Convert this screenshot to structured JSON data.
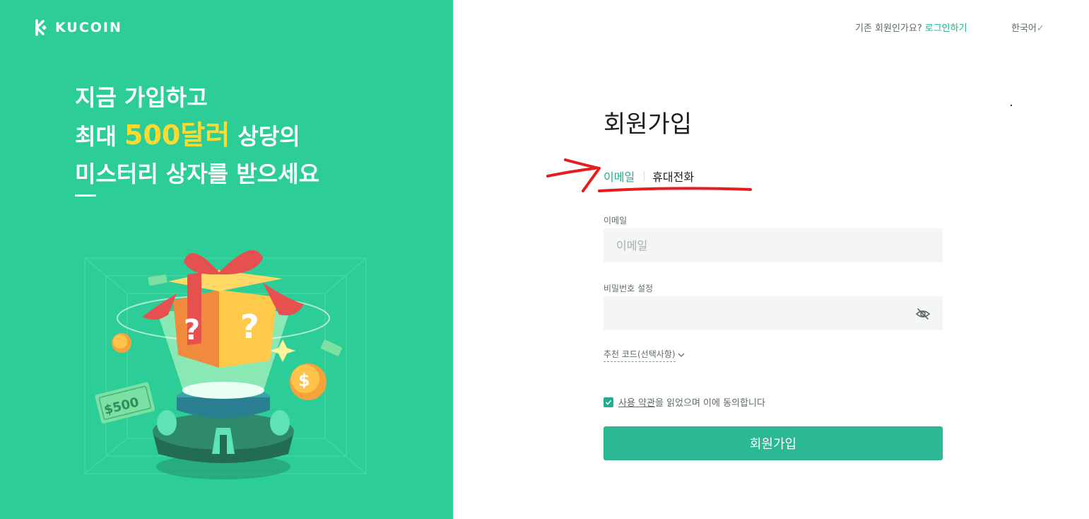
{
  "brand": {
    "name": "KUCOIN",
    "accent": "#24ae8f",
    "panel_color": "#2ccd96",
    "highlight_color": "#ffd92e"
  },
  "promo": {
    "line1": "지금 가입하고",
    "line2_prefix": "최대 ",
    "line2_highlight": "500달러",
    "line2_suffix": " 상당의",
    "line3": "미스터리 상자를 받으세요",
    "bill_label": "$500"
  },
  "header": {
    "login_prompt": "기존 회원인가요?",
    "login_link": "로그인하기",
    "language": "한국어",
    "language_caret": "✓"
  },
  "form": {
    "title": "회원가입",
    "tabs": [
      {
        "label": "이메일",
        "active": true
      },
      {
        "label": "휴대전화",
        "active": false
      }
    ],
    "email": {
      "label": "이메일",
      "placeholder": "이메일",
      "value": ""
    },
    "password": {
      "label": "비밀번호 설정",
      "value": "",
      "toggle_icon": "eye-slash-icon"
    },
    "referral": {
      "label": "추천 코드(선택사항)",
      "icon": "chevron-down-icon"
    },
    "terms": {
      "checked": true,
      "link_text": "사용 약관",
      "suffix": "을 읽었으며 이에 동의합니다"
    },
    "submit_label": "회원가입"
  },
  "annotation": {
    "color": "#e41e1e"
  }
}
